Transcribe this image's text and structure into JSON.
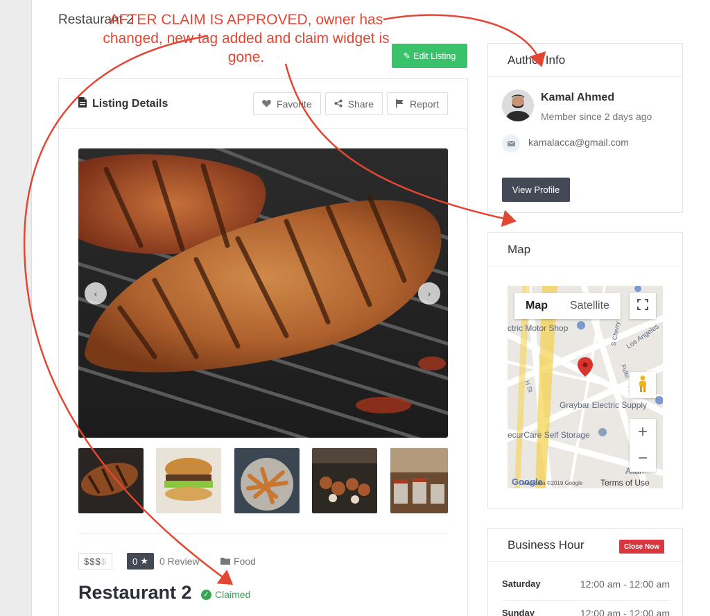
{
  "page": {
    "title": "Restaurant 2",
    "edit_button": "Edit Listing"
  },
  "annotation": {
    "text": "AFTER CLAIM IS APPROVED, owner has changed, new tag added and claim widget is gone.",
    "color": "#e34632"
  },
  "listing": {
    "header": "Listing Details",
    "actions": [
      {
        "label": "Favorite",
        "icon": "heart-icon"
      },
      {
        "label": "Share",
        "icon": "share-icon"
      },
      {
        "label": "Report",
        "icon": "flag-icon"
      }
    ],
    "price_active": "$$$",
    "price_inactive": "$",
    "rating": "0",
    "review_label": "0 Review",
    "category": "Food",
    "name": "Restaurant 2",
    "claimed_label": "Claimed"
  },
  "author": {
    "header": "Author Info",
    "name": "Kamal Ahmed",
    "since": "Member since 2 days ago",
    "email": "kamalacca@gmail.com",
    "view_button": "View Profile"
  },
  "map": {
    "header": "Map",
    "tab_map": "Map",
    "tab_satellite": "Satellite",
    "labels": {
      "motor_shop": "ctric Motor Shop",
      "graybar": "Graybar Electric Supply",
      "storage": "ecurCare Self Storage",
      "los_angeles": "Los Angeles",
      "allan": "Allan",
      "s_cherry": "S Cherry",
      "h_st": "H St",
      "fulto": "Fulto"
    },
    "google": "Google",
    "map_data": "Map data ©2019 Google",
    "terms": "Terms of Use",
    "zoom_in": "+",
    "zoom_out": "−"
  },
  "hours": {
    "header": "Business Hour",
    "status": "Close Now",
    "rows": [
      {
        "day": "Saturday",
        "time": "12:00 am - 12:00 am"
      },
      {
        "day": "Sunday",
        "time": "12:00 am - 12:00 am"
      }
    ]
  },
  "colors": {
    "green": "#3ac26b",
    "dark_button": "#444a55",
    "claimed_green": "#3aa655",
    "close_red": "#d9363e"
  }
}
